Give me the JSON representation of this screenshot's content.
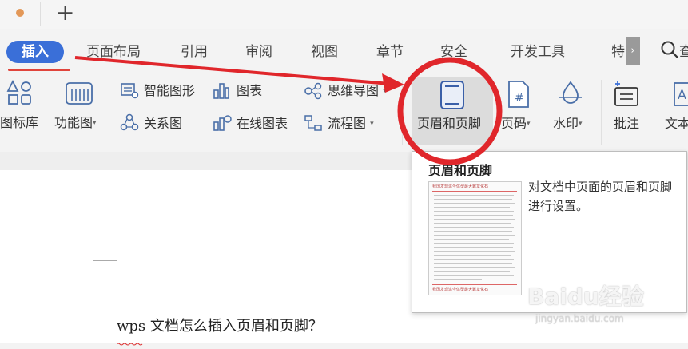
{
  "tabbar": {
    "new_tab": "+"
  },
  "menu": {
    "items": [
      "插入",
      "页面布局",
      "引用",
      "审阅",
      "视图",
      "章节",
      "安全",
      "开发工具",
      "特"
    ],
    "more": "›",
    "search_partial": "查"
  },
  "toolbar": {
    "icon_lib": "图标库",
    "function_chart": "功能图",
    "smart_shape": "智能图形",
    "relation_chart": "关系图",
    "chart": "图表",
    "online_chart": "在线图表",
    "mind_map": "思维导图",
    "flow_chart": "流程图",
    "header_footer": "页眉和页脚",
    "page_number": "页码",
    "watermark": "水印",
    "comment": "批注",
    "text_partial": "文本"
  },
  "tooltip": {
    "title": "页眉和页脚",
    "description": "对文档中页面的页眉和页脚进行设置。",
    "preview_header": "我国发现迄今体型最大翼龙化石",
    "preview_footer": "我国发现迄今体型最大翼龙化石"
  },
  "document": {
    "question": "wps 文档怎么插入页眉和页脚？"
  },
  "watermark": {
    "brand": "Baidu经验",
    "url": "jingyan.baidu.com"
  },
  "colors": {
    "accent": "#3a6fd8",
    "annotation": "#e0262b"
  }
}
